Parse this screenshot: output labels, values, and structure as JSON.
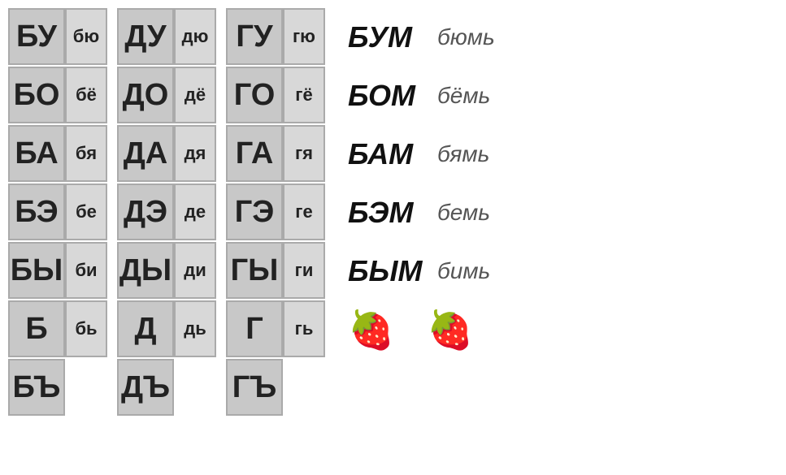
{
  "columns": {
    "b_large": [
      "БУ",
      "БО",
      "БА",
      "БЭ",
      "БЫ",
      "Б",
      "БЪ"
    ],
    "b_small": [
      "бю",
      "бё",
      "бя",
      "бе",
      "би",
      "бь",
      ""
    ],
    "d_large": [
      "ДУ",
      "ДО",
      "ДА",
      "ДЭ",
      "ДЫ",
      "Д",
      "ДЪ"
    ],
    "d_small": [
      "дю",
      "дё",
      "дя",
      "де",
      "ди",
      "дь",
      ""
    ],
    "g_large": [
      "ГУ",
      "ГО",
      "ГА",
      "ГЭ",
      "ГЫ",
      "Г",
      "ГЪ"
    ],
    "g_small": [
      "гю",
      "гё",
      "гя",
      "ге",
      "ги",
      "гь",
      ""
    ]
  },
  "words": [
    {
      "bold": "БУМ",
      "light": "бюмь"
    },
    {
      "bold": "БОМ",
      "light": "бёмь"
    },
    {
      "bold": "БАМ",
      "light": "бямь"
    },
    {
      "bold": "БЭМ",
      "light": "бемь"
    },
    {
      "bold": "БЫМ",
      "light": "бимь"
    }
  ]
}
